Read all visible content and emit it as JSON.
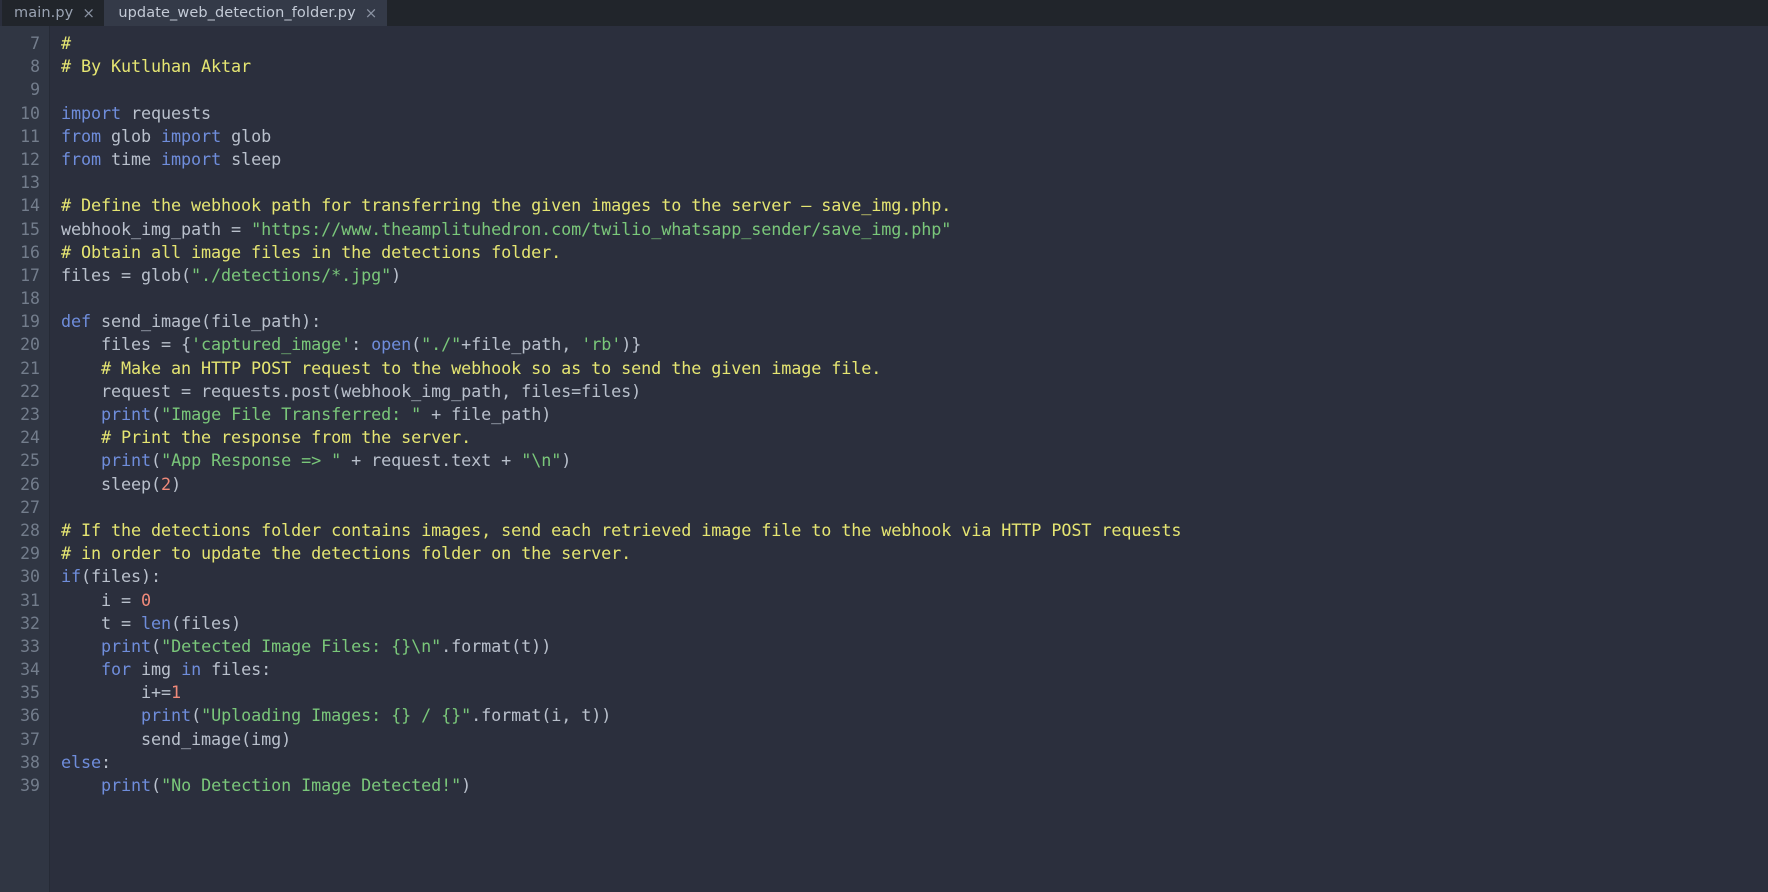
{
  "window": {
    "app_kind": "code-editor",
    "theme": "dark"
  },
  "tabbar": {
    "tabs": [
      {
        "label": "main.py",
        "close": "×",
        "active": false
      },
      {
        "label": "update_web_detection_folder.py",
        "close": "×",
        "active": true
      }
    ]
  },
  "colors": {
    "background": "#2b2f3d",
    "gutter_background": "#303643",
    "tabbar_background": "#21252b",
    "active_tab_background": "#343a48",
    "comment": "#e5e572",
    "string": "#7ac77a",
    "keyword": "#6f8ddb",
    "builtin": "#6f8ddb",
    "number": "#f08a7a",
    "plain": "#b9c0cc",
    "line_number": "#737d8c"
  },
  "editor": {
    "first_line_number": 7,
    "last_line_number": 39,
    "language": "python",
    "line_numbers": [
      7,
      8,
      9,
      10,
      11,
      12,
      13,
      14,
      15,
      16,
      17,
      18,
      19,
      20,
      21,
      22,
      23,
      24,
      25,
      26,
      27,
      28,
      29,
      30,
      31,
      32,
      33,
      34,
      35,
      36,
      37,
      38,
      39
    ],
    "lines": [
      {
        "n": 7,
        "tokens": [
          {
            "t": "#",
            "c": "com"
          }
        ]
      },
      {
        "n": 8,
        "tokens": [
          {
            "t": "# By Kutluhan Aktar",
            "c": "com"
          }
        ]
      },
      {
        "n": 9,
        "tokens": []
      },
      {
        "n": 10,
        "tokens": [
          {
            "t": "import",
            "c": "kw"
          },
          {
            "t": " requests",
            "c": "pl"
          }
        ]
      },
      {
        "n": 11,
        "tokens": [
          {
            "t": "from",
            "c": "kw"
          },
          {
            "t": " glob ",
            "c": "pl"
          },
          {
            "t": "import",
            "c": "kw"
          },
          {
            "t": " glob",
            "c": "pl"
          }
        ]
      },
      {
        "n": 12,
        "tokens": [
          {
            "t": "from",
            "c": "kw"
          },
          {
            "t": " time ",
            "c": "pl"
          },
          {
            "t": "import",
            "c": "kw"
          },
          {
            "t": " sleep",
            "c": "pl"
          }
        ]
      },
      {
        "n": 13,
        "tokens": []
      },
      {
        "n": 14,
        "tokens": [
          {
            "t": "# Define the webhook path for transferring the given images to the server – save_img.php.",
            "c": "com"
          }
        ]
      },
      {
        "n": 15,
        "tokens": [
          {
            "t": "webhook_img_path = ",
            "c": "pl"
          },
          {
            "t": "\"https://www.theamplituhedron.com/twilio_whatsapp_sender/save_img.php\"",
            "c": "str"
          }
        ]
      },
      {
        "n": 16,
        "tokens": [
          {
            "t": "# Obtain all image files in the detections folder.",
            "c": "com"
          }
        ]
      },
      {
        "n": 17,
        "tokens": [
          {
            "t": "files = glob(",
            "c": "pl"
          },
          {
            "t": "\"./detections/*.jpg\"",
            "c": "str"
          },
          {
            "t": ")",
            "c": "pl"
          }
        ]
      },
      {
        "n": 18,
        "tokens": []
      },
      {
        "n": 19,
        "tokens": [
          {
            "t": "def",
            "c": "kw"
          },
          {
            "t": " send_image(file_path):",
            "c": "pl"
          }
        ]
      },
      {
        "n": 20,
        "tokens": [
          {
            "t": "    files = {",
            "c": "pl"
          },
          {
            "t": "'captured_image'",
            "c": "str"
          },
          {
            "t": ": ",
            "c": "pl"
          },
          {
            "t": "open",
            "c": "bi"
          },
          {
            "t": "(",
            "c": "pl"
          },
          {
            "t": "\"./\"",
            "c": "str"
          },
          {
            "t": "+file_path, ",
            "c": "pl"
          },
          {
            "t": "'rb'",
            "c": "str"
          },
          {
            "t": ")}",
            "c": "pl"
          }
        ]
      },
      {
        "n": 21,
        "tokens": [
          {
            "t": "    # Make an HTTP POST request to the webhook so as to send the given image file.",
            "c": "com"
          }
        ]
      },
      {
        "n": 22,
        "tokens": [
          {
            "t": "    request = requests.post(webhook_img_path, files=files)",
            "c": "pl"
          }
        ]
      },
      {
        "n": 23,
        "tokens": [
          {
            "t": "    ",
            "c": "pl"
          },
          {
            "t": "print",
            "c": "bi"
          },
          {
            "t": "(",
            "c": "pl"
          },
          {
            "t": "\"Image File Transferred: \"",
            "c": "str"
          },
          {
            "t": " + file_path)",
            "c": "pl"
          }
        ]
      },
      {
        "n": 24,
        "tokens": [
          {
            "t": "    # Print the response from the server.",
            "c": "com"
          }
        ]
      },
      {
        "n": 25,
        "tokens": [
          {
            "t": "    ",
            "c": "pl"
          },
          {
            "t": "print",
            "c": "bi"
          },
          {
            "t": "(",
            "c": "pl"
          },
          {
            "t": "\"App Response => \"",
            "c": "str"
          },
          {
            "t": " + request.text + ",
            "c": "pl"
          },
          {
            "t": "\"\\n\"",
            "c": "str"
          },
          {
            "t": ")",
            "c": "pl"
          }
        ]
      },
      {
        "n": 26,
        "tokens": [
          {
            "t": "    sleep(",
            "c": "pl"
          },
          {
            "t": "2",
            "c": "num"
          },
          {
            "t": ")",
            "c": "pl"
          }
        ]
      },
      {
        "n": 27,
        "tokens": []
      },
      {
        "n": 28,
        "tokens": [
          {
            "t": "# If the detections folder contains images, send each retrieved image file to the webhook via HTTP POST requests",
            "c": "com"
          }
        ]
      },
      {
        "n": 29,
        "tokens": [
          {
            "t": "# in order to update the detections folder on the server.",
            "c": "com"
          }
        ]
      },
      {
        "n": 30,
        "tokens": [
          {
            "t": "if",
            "c": "kw"
          },
          {
            "t": "(files):",
            "c": "pl"
          }
        ]
      },
      {
        "n": 31,
        "tokens": [
          {
            "t": "    i = ",
            "c": "pl"
          },
          {
            "t": "0",
            "c": "num"
          }
        ]
      },
      {
        "n": 32,
        "tokens": [
          {
            "t": "    t = ",
            "c": "pl"
          },
          {
            "t": "len",
            "c": "bi"
          },
          {
            "t": "(files)",
            "c": "pl"
          }
        ]
      },
      {
        "n": 33,
        "tokens": [
          {
            "t": "    ",
            "c": "pl"
          },
          {
            "t": "print",
            "c": "bi"
          },
          {
            "t": "(",
            "c": "pl"
          },
          {
            "t": "\"Detected Image Files: {}\\n\"",
            "c": "str"
          },
          {
            "t": ".format(t))",
            "c": "pl"
          }
        ]
      },
      {
        "n": 34,
        "tokens": [
          {
            "t": "    ",
            "c": "pl"
          },
          {
            "t": "for",
            "c": "kw"
          },
          {
            "t": " img ",
            "c": "pl"
          },
          {
            "t": "in",
            "c": "kw"
          },
          {
            "t": " files:",
            "c": "pl"
          }
        ]
      },
      {
        "n": 35,
        "tokens": [
          {
            "t": "        i+=",
            "c": "pl"
          },
          {
            "t": "1",
            "c": "num"
          }
        ]
      },
      {
        "n": 36,
        "tokens": [
          {
            "t": "        ",
            "c": "pl"
          },
          {
            "t": "print",
            "c": "bi"
          },
          {
            "t": "(",
            "c": "pl"
          },
          {
            "t": "\"Uploading Images: {} / {}\"",
            "c": "str"
          },
          {
            "t": ".format(i, t))",
            "c": "pl"
          }
        ]
      },
      {
        "n": 37,
        "tokens": [
          {
            "t": "        send_image(img)",
            "c": "pl"
          }
        ]
      },
      {
        "n": 38,
        "tokens": [
          {
            "t": "else",
            "c": "kw"
          },
          {
            "t": ":",
            "c": "pl"
          }
        ]
      },
      {
        "n": 39,
        "tokens": [
          {
            "t": "    ",
            "c": "pl"
          },
          {
            "t": "print",
            "c": "bi"
          },
          {
            "t": "(",
            "c": "pl"
          },
          {
            "t": "\"No Detection Image Detected!\"",
            "c": "str"
          },
          {
            "t": ")",
            "c": "pl"
          }
        ]
      }
    ]
  }
}
